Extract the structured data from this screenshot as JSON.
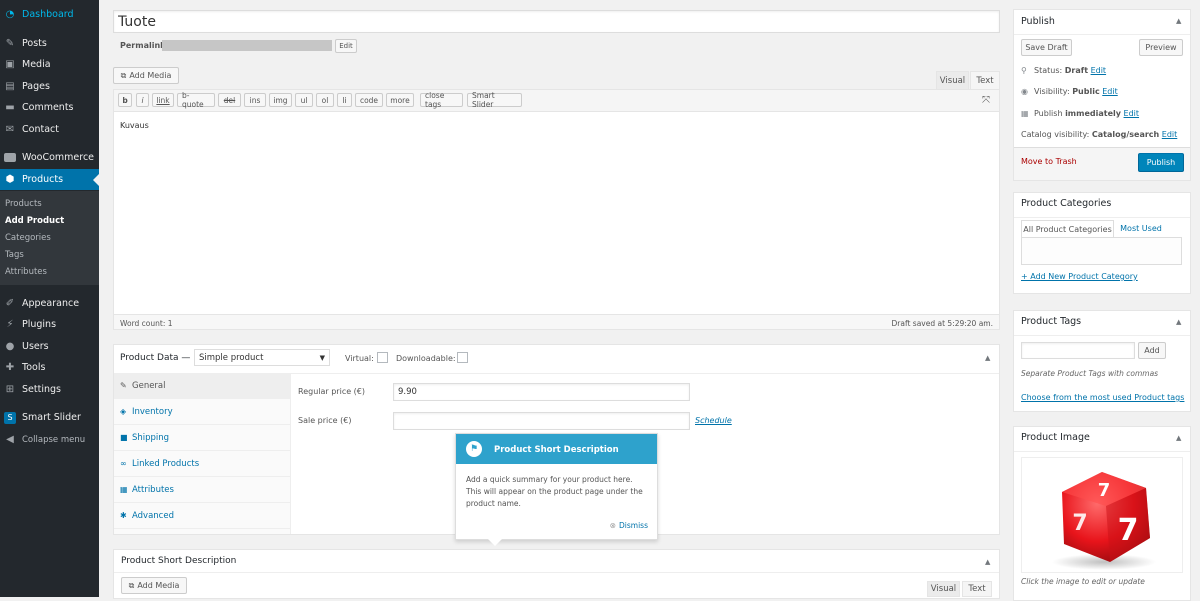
{
  "sidebar": {
    "items": [
      {
        "label": "Dashboard",
        "icon": "dashboard-icon"
      },
      {
        "label": "Posts",
        "icon": "pin-icon"
      },
      {
        "label": "Media",
        "icon": "media-icon"
      },
      {
        "label": "Pages",
        "icon": "pages-icon"
      },
      {
        "label": "Comments",
        "icon": "comments-icon"
      },
      {
        "label": "Contact",
        "icon": "mail-icon"
      },
      {
        "label": "WooCommerce",
        "icon": "woocommerce-icon"
      },
      {
        "label": "Products",
        "icon": "products-icon"
      },
      {
        "label": "Appearance",
        "icon": "brush-icon"
      },
      {
        "label": "Plugins",
        "icon": "plugin-icon"
      },
      {
        "label": "Users",
        "icon": "users-icon"
      },
      {
        "label": "Tools",
        "icon": "tools-icon"
      },
      {
        "label": "Settings",
        "icon": "settings-icon"
      },
      {
        "label": "Smart Slider",
        "icon": "smart-slider-icon"
      },
      {
        "label": "Collapse menu",
        "icon": "collapse-icon"
      }
    ],
    "submenu": [
      "Products",
      "Add Product",
      "Categories",
      "Tags",
      "Attributes"
    ]
  },
  "editor": {
    "title_value": "Tuote",
    "permalink_label": "Permalink:",
    "edit_label": "Edit",
    "add_media": "Add Media",
    "tab_visual": "Visual",
    "tab_text": "Text",
    "quicktags": [
      "b",
      "i",
      "link",
      "b-quote",
      "del",
      "ins",
      "img",
      "ul",
      "ol",
      "li",
      "code",
      "more",
      "close tags",
      "Smart Slider"
    ],
    "content": "Kuvaus",
    "word_count": "Word count: 1",
    "draft_saved": "Draft saved at 5:29:20 am."
  },
  "product_data": {
    "label": "Product Data —",
    "type_selected": "Simple product",
    "virtual_label": "Virtual:",
    "downloadable_label": "Downloadable:",
    "tabs": [
      {
        "label": "General",
        "icon": "wrench-icon"
      },
      {
        "label": "Inventory",
        "icon": "inventory-icon"
      },
      {
        "label": "Shipping",
        "icon": "truck-icon"
      },
      {
        "label": "Linked Products",
        "icon": "link-icon"
      },
      {
        "label": "Attributes",
        "icon": "attributes-icon"
      },
      {
        "label": "Advanced",
        "icon": "gear-icon"
      }
    ],
    "regular_price_label": "Regular price (€)",
    "regular_price_value": "9.90",
    "sale_price_label": "Sale price (€)",
    "sale_price_value": "",
    "schedule": "Schedule"
  },
  "pointer": {
    "title": "Product Short Description",
    "body": "Add a quick summary for your product here. This will appear on the product page under the product name.",
    "dismiss": "Dismiss"
  },
  "short_desc": {
    "title": "Product Short Description",
    "add_media": "Add Media",
    "tab_visual": "Visual",
    "tab_text": "Text"
  },
  "publish": {
    "title": "Publish",
    "save_draft": "Save Draft",
    "preview": "Preview",
    "status_label": "Status:",
    "status_value": "Draft",
    "visibility_label": "Visibility:",
    "visibility_value": "Public",
    "publish_label": "Publish",
    "publish_value": "immediately",
    "catalog_label": "Catalog visibility:",
    "catalog_value": "Catalog/search",
    "edit": "Edit",
    "trash": "Move to Trash",
    "publish_button": "Publish"
  },
  "categories": {
    "title": "Product Categories",
    "tab_all": "All Product Categories",
    "tab_used": "Most Used",
    "add_new": "+ Add New Product Category"
  },
  "tags": {
    "title": "Product Tags",
    "input_value": "",
    "add": "Add",
    "help": "Separate Product Tags with commas",
    "choose": "Choose from the most used Product tags"
  },
  "image": {
    "title": "Product Image",
    "caption": "Click the image to edit or update"
  },
  "colors": {
    "sidebar": "#23282d",
    "accent": "#0073aa",
    "pointer_header": "#2ea2cc",
    "trash": "#a00"
  }
}
